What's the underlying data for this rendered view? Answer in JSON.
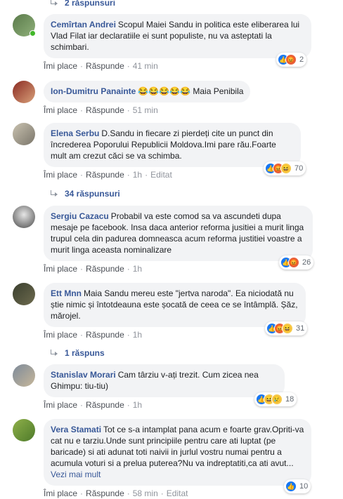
{
  "replies_top": "2 răspunsuri",
  "actions": {
    "like": "Îmi place",
    "reply": "Răspunde",
    "sep": "·"
  },
  "comments": [
    {
      "author": "Cemîrtan Andrei",
      "text": "Scopul Maiei Sandu in politica este eliberarea lui Vlad Filat iar declaratiile ei sunt populiste, nu va asteptati la schimbari.",
      "time": "41 min",
      "edited": "",
      "reactions_count": "2",
      "reactions": [
        "like-icon",
        "angry-icon"
      ]
    },
    {
      "author": "Ion-Dumitru Panainte",
      "text": "😂😂😂😂😂 Maia Penibila",
      "time": "51 min",
      "edited": "",
      "reactions_count": "",
      "reactions": []
    },
    {
      "author": "Elena Serbu",
      "text": "D.Sandu in fiecare zi pierdeți cite un punct din încrederea Poporului Republicii Moldova.Imi pare rău.Foarte mult am crezut căci se va schimba.",
      "time": "1h",
      "edited": "Editat",
      "reactions_count": "70",
      "reactions": [
        "like-icon",
        "angry-icon",
        "haha-icon"
      ]
    },
    {
      "author": "Sergiu Cazacu",
      "text": "Probabil va este comod sa va ascundeti dupa mesaje pe facebook. Insa daca anterior reforma jusitiei a murit linga trupul cela din padurea domneasca acum reforma justitiei voastre a murit linga aceasta nominalizare",
      "time": "1h",
      "edited": "",
      "reactions_count": "26",
      "reactions": [
        "like-icon",
        "angry-icon"
      ]
    },
    {
      "author": "Ett Mnn",
      "text": "Maia Sandu mereu este \"jertva naroda\". Ea niciodată nu știe nimic și întotdeauna este șocată de ceea ce se întâmplă. Șăz, mărojel.",
      "time": "1h",
      "edited": "",
      "reactions_count": "31",
      "reactions": [
        "like-icon",
        "angry-icon",
        "haha-icon"
      ]
    },
    {
      "author": "Stanislav Morari",
      "text": "Cam târziu v-ați trezit. Cum zicea nea Ghimpu: tiu-tiu)",
      "time": "1h",
      "edited": "",
      "reactions_count": "18",
      "reactions": [
        "like-icon",
        "haha-icon",
        "sad-icon"
      ]
    },
    {
      "author": "Vera Stamati",
      "text": "Tot ce s-a intamplat pana acum e foarte grav.Opriti-va cat nu e tarziu.Unde sunt principiile pentru care ati luptat (pe baricade) si ati adunat toti naivii in jurlul vostru numai pentru a acumula voturi si a prelua puterea?Nu va indreptatiti,ca ati avut...",
      "see_more": "Vezi mai mult",
      "time": "58 min",
      "edited": "Editat",
      "reactions_count": "10",
      "reactions": [
        "like-icon"
      ]
    }
  ],
  "reply_toggles": [
    "34 răspunsuri",
    "1 răspuns"
  ],
  "colors": {
    "link": "#385898",
    "bubble": "#f2f3f5",
    "like": "#1877f2",
    "angry": "#e8603c",
    "haha": "#f7c948",
    "online": "#42b72a"
  }
}
